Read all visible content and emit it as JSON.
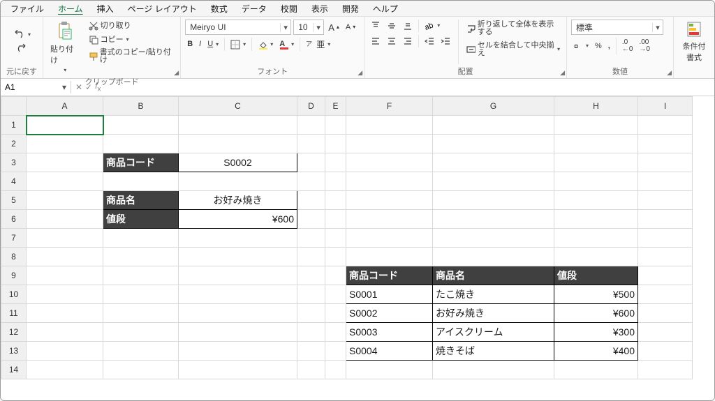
{
  "menu": {
    "items": [
      "ファイル",
      "ホーム",
      "挿入",
      "ページ レイアウト",
      "数式",
      "データ",
      "校閲",
      "表示",
      "開発",
      "ヘルプ"
    ],
    "activeIndex": 1
  },
  "ribbon": {
    "undo": {
      "label": "元に戻す"
    },
    "clipboard": {
      "paste": "貼り付け",
      "cut": "切り取り",
      "copy": "コピー",
      "formatPainter": "書式のコピー/貼り付け",
      "group": "クリップボード"
    },
    "font": {
      "group": "フォント",
      "name": "Meiryo UI",
      "size": "10"
    },
    "align": {
      "group": "配置",
      "wrap": "折り返して全体を表示する",
      "merge": "セルを結合して中央揃え"
    },
    "number": {
      "group": "数値",
      "format": "標準"
    },
    "styles": {
      "cond": "条件付\n書式"
    }
  },
  "namebox": "A1",
  "formula": "",
  "cols": [
    "A",
    "B",
    "C",
    "D",
    "E",
    "F",
    "G",
    "H",
    "I"
  ],
  "rows": [
    "1",
    "2",
    "3",
    "4",
    "5",
    "6",
    "7",
    "8",
    "9",
    "10",
    "11",
    "12",
    "13",
    "14"
  ],
  "cells": {
    "B3": {
      "v": "商品コード",
      "cls": "darkhdr"
    },
    "C3": {
      "v": "S0002",
      "cls": "boxed"
    },
    "B5": {
      "v": "商品名",
      "cls": "darkhdr"
    },
    "C5": {
      "v": "お好み焼き",
      "cls": "boxed"
    },
    "B6": {
      "v": "値段",
      "cls": "darkhdr"
    },
    "C6": {
      "v": "¥600",
      "cls": "boxed-r"
    },
    "F9": {
      "v": "商品コード",
      "cls": "tbl-hdr"
    },
    "G9": {
      "v": "商品名",
      "cls": "tbl-hdr"
    },
    "H9": {
      "v": "値段",
      "cls": "tbl-hdr"
    },
    "F10": {
      "v": "S0001",
      "cls": "tbl-cell"
    },
    "G10": {
      "v": "たこ焼き",
      "cls": "tbl-cell"
    },
    "H10": {
      "v": "¥500",
      "cls": "tbl-cell-r"
    },
    "F11": {
      "v": "S0002",
      "cls": "tbl-cell"
    },
    "G11": {
      "v": "お好み焼き",
      "cls": "tbl-cell"
    },
    "H11": {
      "v": "¥600",
      "cls": "tbl-cell-r"
    },
    "F12": {
      "v": "S0003",
      "cls": "tbl-cell"
    },
    "G12": {
      "v": "アイスクリーム",
      "cls": "tbl-cell"
    },
    "H12": {
      "v": "¥300",
      "cls": "tbl-cell-r"
    },
    "F13": {
      "v": "S0004",
      "cls": "tbl-cell"
    },
    "G13": {
      "v": "焼きそば",
      "cls": "tbl-cell"
    },
    "H13": {
      "v": "¥400",
      "cls": "tbl-cell-r"
    }
  },
  "activeCell": "A1"
}
